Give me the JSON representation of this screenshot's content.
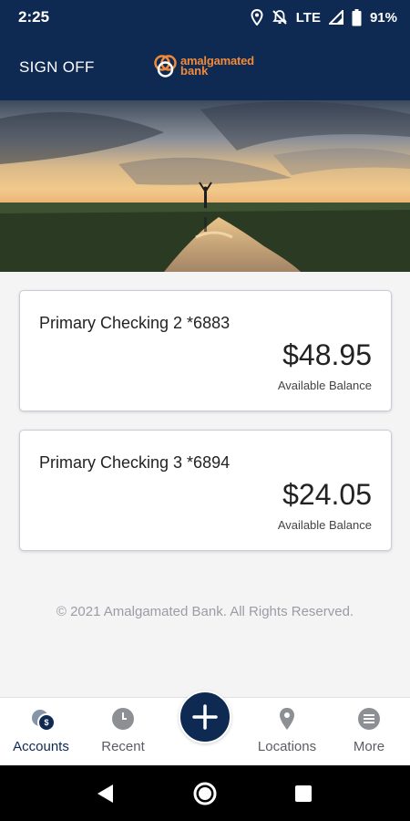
{
  "status_bar": {
    "time": "2:25",
    "network": "LTE",
    "battery": "91%"
  },
  "header": {
    "sign_off_label": "SIGN OFF",
    "logo_line1": "amalgamated",
    "logo_line2": "bank"
  },
  "accounts": [
    {
      "name": "Primary Checking 2 *6883",
      "balance": "$48.95",
      "caption": "Available Balance"
    },
    {
      "name": "Primary Checking 3 *6894",
      "balance": "$24.05",
      "caption": "Available Balance"
    }
  ],
  "footer": {
    "copyright": "© 2021 Amalgamated Bank. All Rights Reserved."
  },
  "tabs": [
    {
      "label": "Accounts",
      "icon": "accounts-icon",
      "active": true,
      "badge": "$"
    },
    {
      "label": "Recent",
      "icon": "clock-icon"
    },
    {
      "label": "Locations",
      "icon": "location-pin-icon"
    },
    {
      "label": "More",
      "icon": "menu-icon"
    }
  ],
  "fab": {
    "icon": "plus-icon"
  },
  "system_nav": {
    "back": "back-triangle-icon",
    "home": "home-circle-icon",
    "recents": "recents-square-icon"
  },
  "colors": {
    "brand_navy": "#0e2a52",
    "logo_orange": "#f08a3a",
    "background": "#f4f4f5"
  }
}
